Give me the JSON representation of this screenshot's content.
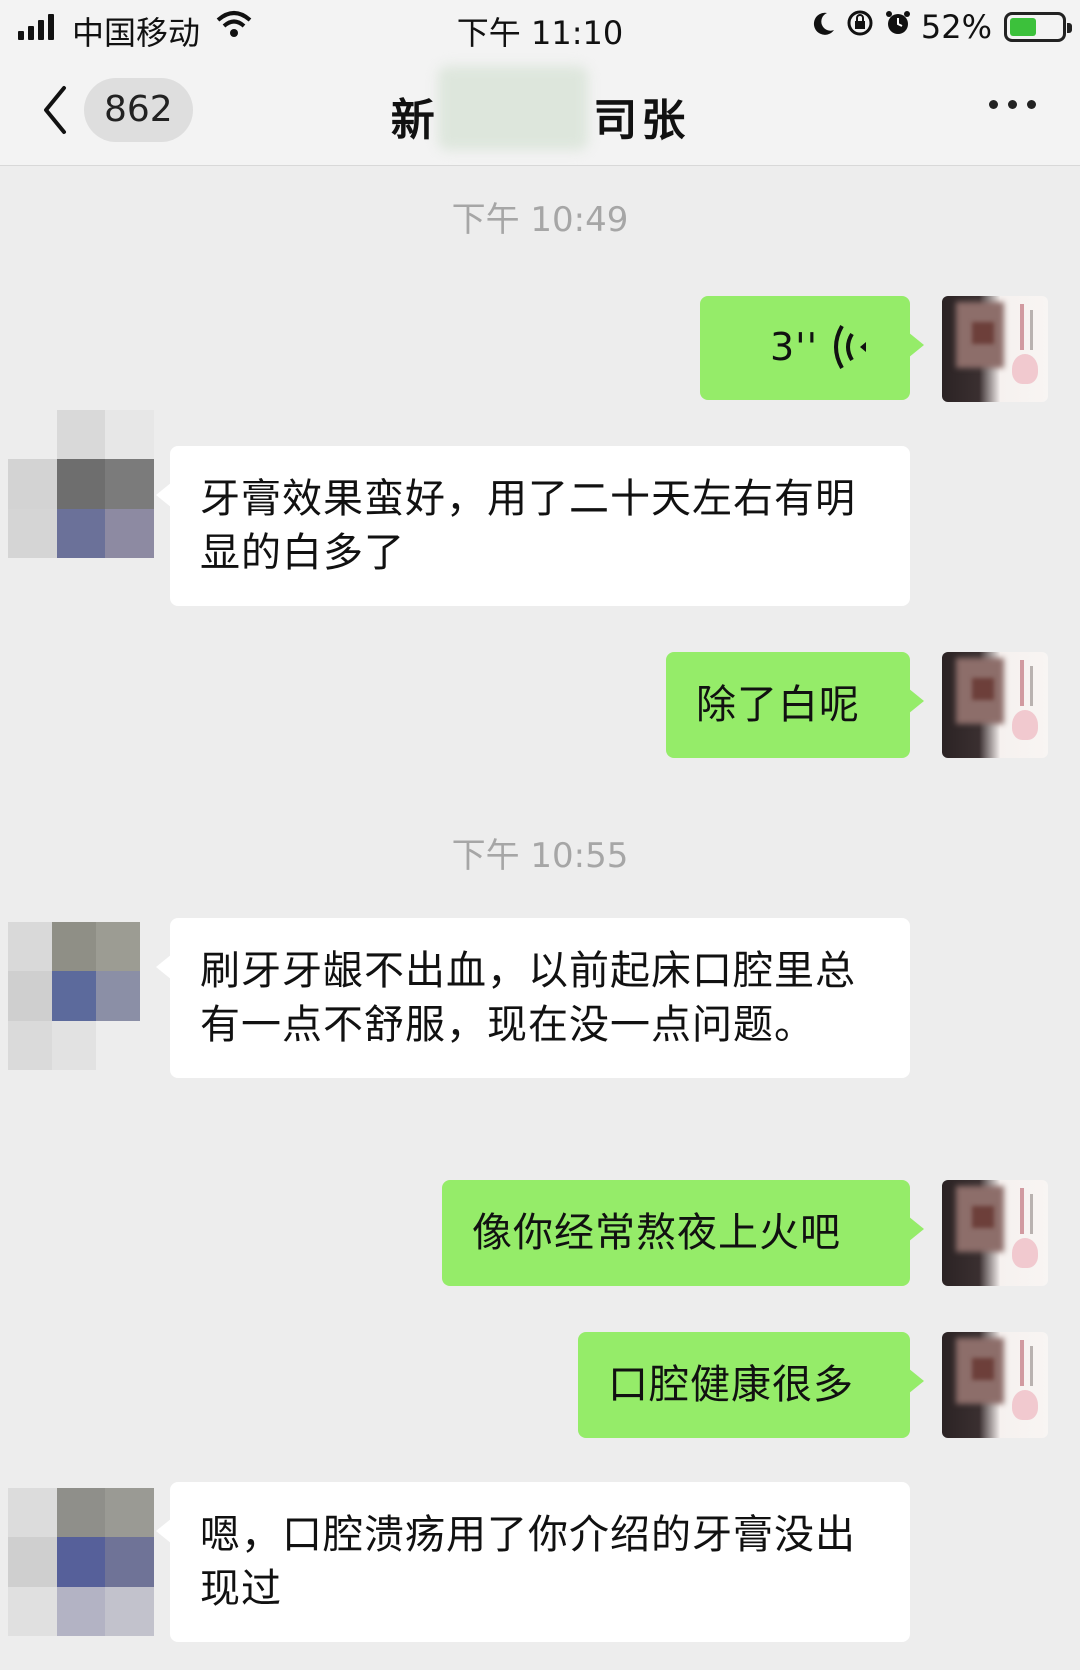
{
  "status_bar": {
    "carrier": "中国移动",
    "time": "下午 11:10",
    "battery": "52%",
    "battery_level": 0.52,
    "icons": [
      "signal-icon",
      "wifi-icon",
      "moon-icon",
      "rotation-lock-icon",
      "alarm-icon",
      "battery-charging-icon"
    ]
  },
  "nav": {
    "back_icon": "chevron-left-icon",
    "unread_count": "862",
    "title": "新        司张",
    "more_icon": "more-dots-icon"
  },
  "messages": [
    {
      "type": "timestamp",
      "text": "下午 10:49"
    },
    {
      "type": "voice",
      "from": "me",
      "duration": "3''"
    },
    {
      "type": "text",
      "from": "other",
      "text": "牙膏效果蛮好，用了二十天左右有明显的白多了"
    },
    {
      "type": "text",
      "from": "me",
      "text": "除了白呢"
    },
    {
      "type": "timestamp",
      "text": "下午 10:55"
    },
    {
      "type": "text",
      "from": "other",
      "text": "刷牙牙龈不出血，以前起床口腔里总有一点不舒服，现在没一点问题。"
    },
    {
      "type": "text",
      "from": "me",
      "text": "像你经常熬夜上火吧"
    },
    {
      "type": "text",
      "from": "me",
      "text": "口腔健康很多"
    },
    {
      "type": "text",
      "from": "other",
      "text": "嗯，口腔溃疡用了你介绍的牙膏没出现过"
    }
  ],
  "colors": {
    "background": "#ededed",
    "my_bubble": "#95ec69",
    "other_bubble": "#ffffff",
    "timestamp": "#a6a6a6"
  }
}
